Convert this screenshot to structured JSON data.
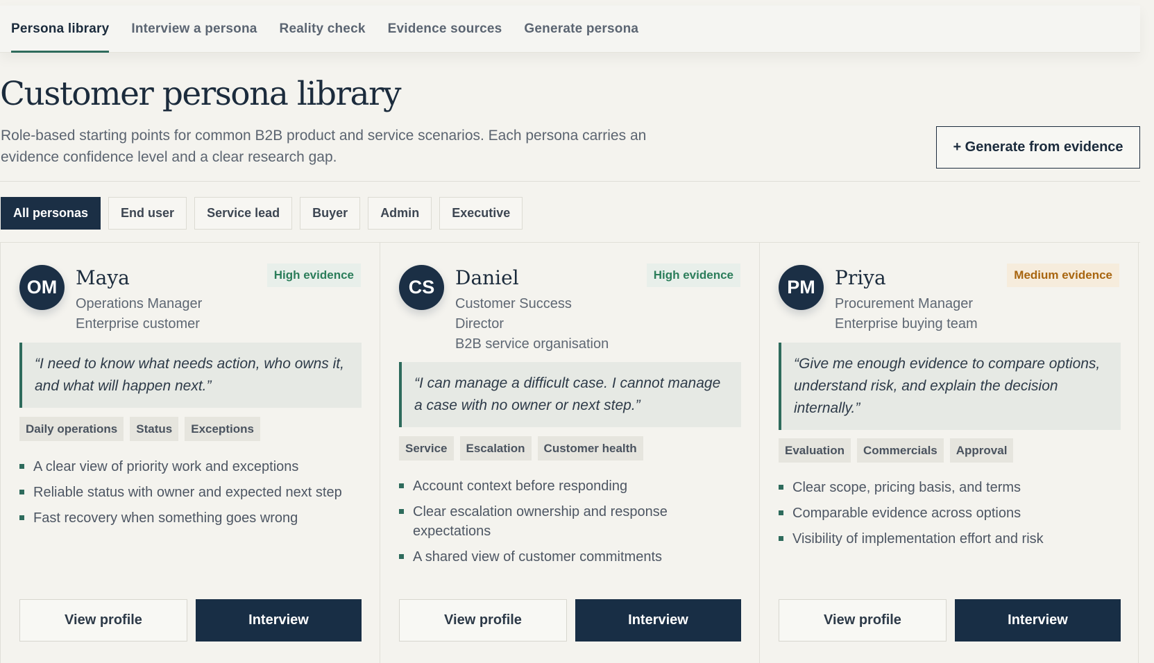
{
  "nav": {
    "tabs": [
      {
        "label": "Persona library"
      },
      {
        "label": "Interview a persona"
      },
      {
        "label": "Reality check"
      },
      {
        "label": "Evidence sources"
      },
      {
        "label": "Generate persona"
      }
    ]
  },
  "header": {
    "title": "Customer persona library",
    "subtitle": "Role-based starting points for common B2B product and service scenarios. Each persona carries an evidence confidence level and a clear research gap.",
    "generate_button": "+ Generate from evidence"
  },
  "filters": [
    "All personas",
    "End user",
    "Service lead",
    "Buyer",
    "Admin",
    "Executive"
  ],
  "cards": [
    {
      "initials": "OM",
      "name": "Maya",
      "role_line1": "Operations Manager",
      "role_line2": "Enterprise customer",
      "evidence": "High evidence",
      "quote": "“I need to know what needs action, who owns it, and what will happen next.”",
      "tags": [
        "Daily operations",
        "Status",
        "Exceptions"
      ],
      "needs": [
        "A clear view of priority work and exceptions",
        "Reliable status with owner and expected next step",
        "Fast recovery when something goes wrong"
      ],
      "view_label": "View profile",
      "interview_label": "Interview"
    },
    {
      "initials": "CS",
      "name": "Daniel",
      "role_line1": "Customer Success Director",
      "role_line2": "B2B service organisation",
      "evidence": "High evidence",
      "quote": "“I can manage a difficult case. I cannot manage a case with no owner or next step.”",
      "tags": [
        "Service",
        "Escalation",
        "Customer health"
      ],
      "needs": [
        "Account context before responding",
        "Clear escalation ownership and response expectations",
        "A shared view of customer commitments"
      ],
      "view_label": "View profile",
      "interview_label": "Interview"
    },
    {
      "initials": "PM",
      "name": "Priya",
      "role_line1": "Procurement Manager",
      "role_line2": "Enterprise buying team",
      "evidence": "Medium evidence",
      "quote": "“Give me enough evidence to compare options, understand risk, and explain the decision internally.”",
      "tags": [
        "Evaluation",
        "Commercials",
        "Approval"
      ],
      "needs": [
        "Clear scope, pricing basis, and terms",
        "Comparable evidence across options",
        "Visibility of implementation effort and risk"
      ],
      "view_label": "View profile",
      "interview_label": "Interview"
    }
  ],
  "colors": {
    "navy": "#1b2f45",
    "accent_green": "#2e6b5c",
    "high_evidence_text": "#2b7d5a",
    "medium_evidence_text": "#a8650f",
    "background": "#f4f3ee"
  }
}
